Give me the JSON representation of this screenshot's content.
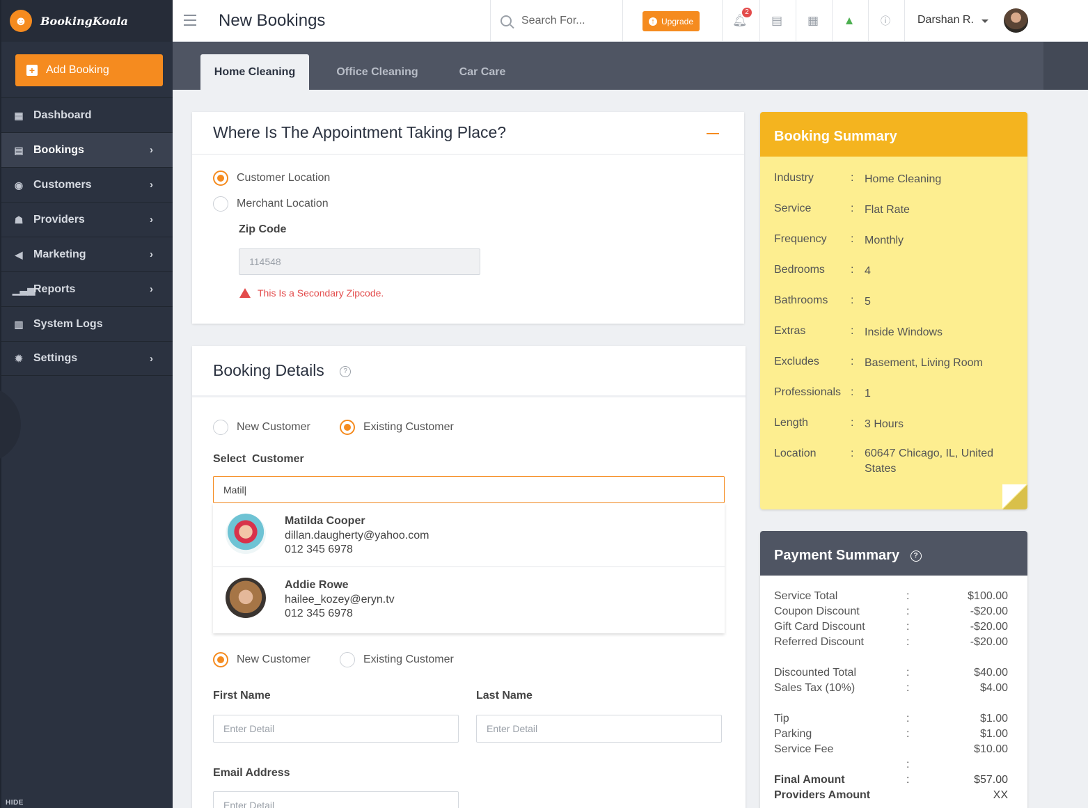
{
  "app": {
    "brand": "BookingKoala",
    "page_title": "New Bookings"
  },
  "sidebar": {
    "add_booking": "Add Booking",
    "items": [
      {
        "label": "Dashboard",
        "icon": "dashboard-icon"
      },
      {
        "label": "Bookings",
        "icon": "bookings-icon"
      },
      {
        "label": "Customers",
        "icon": "customers-icon"
      },
      {
        "label": "Providers",
        "icon": "providers-icon"
      },
      {
        "label": "Marketing",
        "icon": "megaphone-icon"
      },
      {
        "label": "Reports",
        "icon": "chart-icon"
      },
      {
        "label": "System Logs",
        "icon": "clipboard-icon"
      },
      {
        "label": "Settings",
        "icon": "gear-icon"
      }
    ],
    "hide_label": "HIDE"
  },
  "topbar": {
    "search_placeholder": "Search For...",
    "upgrade_label": "Upgrade",
    "notification_count": "2",
    "user_name": "Darshan R."
  },
  "tabs": [
    "Home Cleaning",
    "Office Cleaning",
    "Car Care"
  ],
  "location": {
    "title": "Where Is The Appointment Taking Place?",
    "option_customer": "Customer Location",
    "option_merchant": "Merchant Location",
    "zip_label": "Zip Code",
    "zip_value": "114548",
    "warning": "This Is a Secondary Zipcode."
  },
  "booking_details": {
    "title": "Booking Details",
    "new_customer": "New Customer",
    "existing_customer": "Existing Customer",
    "select_label": "Select  Customer",
    "search_value": "Matil|",
    "results": [
      {
        "name": "Matilda Cooper",
        "email": "dillan.daugherty@yahoo.com",
        "phone": "012 345 6978"
      },
      {
        "name": "Addie Rowe",
        "email": "hailee_kozey@eryn.tv",
        "phone": "012 345 6978"
      }
    ],
    "first_name_label": "First Name",
    "last_name_label": "Last Name",
    "email_label": "Email Address",
    "input_placeholder": "Enter Detail"
  },
  "booking_summary": {
    "title": "Booking Summary",
    "rows": [
      {
        "k": "Industry",
        "v": "Home Cleaning"
      },
      {
        "k": "Service",
        "v": "Flat Rate"
      },
      {
        "k": "Frequency",
        "v": "Monthly"
      },
      {
        "k": "Bedrooms",
        "v": "4"
      },
      {
        "k": "Bathrooms",
        "v": "5"
      },
      {
        "k": "Extras",
        "v": "Inside Windows"
      },
      {
        "k": "Excludes",
        "v": "Basement, Living Room"
      },
      {
        "k": "Professionals",
        "v": "1"
      },
      {
        "k": "Length",
        "v": "3 Hours"
      },
      {
        "k": "Location",
        "v": "60647 Chicago, IL, United States"
      }
    ]
  },
  "payment_summary": {
    "title": "Payment Summary",
    "rows": [
      {
        "k": "Service Total",
        "v": "$100.00"
      },
      {
        "k": "Coupon Discount",
        "v": "-$20.00"
      },
      {
        "k": "Gift Card Discount",
        "v": "-$20.00"
      },
      {
        "k": "Referred Discount",
        "v": "-$20.00"
      },
      {
        "k": "Discounted Total",
        "v": "$40.00"
      },
      {
        "k": "Sales Tax (10%)",
        "v": "$4.00"
      },
      {
        "k": "Tip",
        "v": "$1.00"
      },
      {
        "k": "Parking",
        "v": "$1.00"
      },
      {
        "k": "Service Fee",
        "v": "$10.00"
      },
      {
        "k": "Final Amount",
        "v": "$57.00"
      },
      {
        "k": "Providers Amount",
        "v": "XX"
      }
    ]
  },
  "colors": {
    "accent": "#f58b1f",
    "sidebar": "#2b3240",
    "summary_header": "#f4b41f",
    "summary_body": "#fdee90",
    "error": "#e34b4b"
  }
}
